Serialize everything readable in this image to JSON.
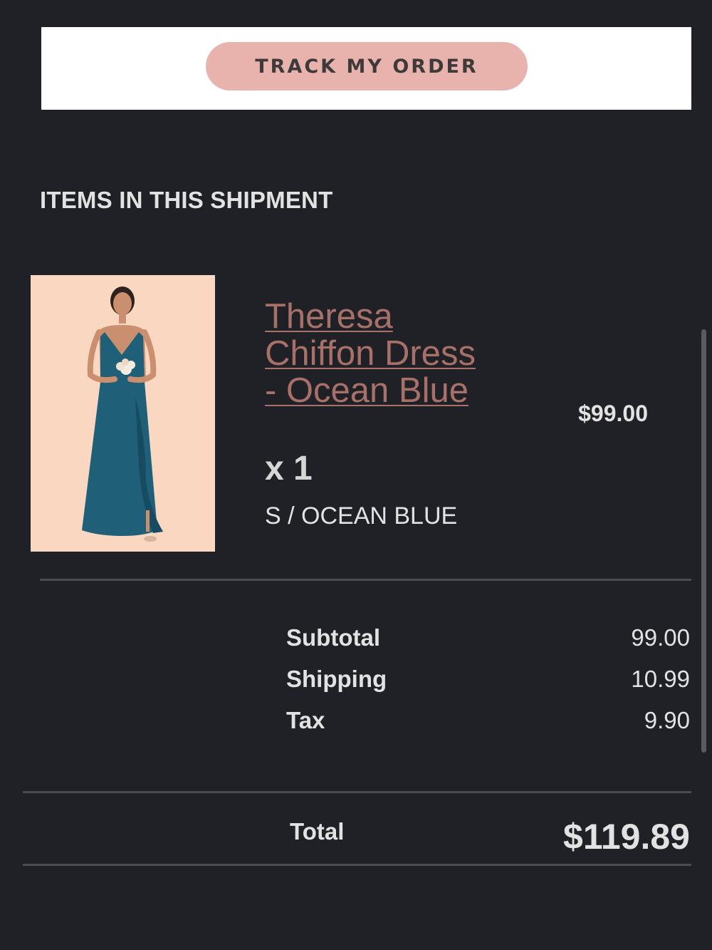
{
  "track_order": {
    "button_label": "TRACK MY ORDER"
  },
  "shipment": {
    "section_title": "ITEMS IN THIS SHIPMENT",
    "items": [
      {
        "name": "Theresa Chiffon Dress - Ocean Blue",
        "quantity_label": "x 1",
        "variant": "S / OCEAN BLUE",
        "price": "$99.00",
        "link_color": "#a77068"
      }
    ]
  },
  "summary": {
    "rows": [
      {
        "label": "Subtotal",
        "value": "99.00"
      },
      {
        "label": "Shipping",
        "value": "10.99"
      },
      {
        "label": "Tax",
        "value": "9.90"
      }
    ],
    "total_label": "Total",
    "total_value": "$119.89"
  },
  "colors": {
    "background": "#202126",
    "button": "#e8b3ad",
    "dress": "#1f5f78",
    "photo_background": "#f9d7c0"
  }
}
